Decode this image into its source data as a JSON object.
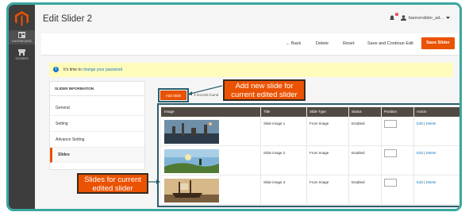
{
  "nav": {
    "items": [
      {
        "label": "DASHBOARD",
        "icon": "dashboard-icon"
      },
      {
        "label": "STORES",
        "icon": "store-icon"
      }
    ]
  },
  "header": {
    "title": "Edit Slider 2",
    "notification_count": "3",
    "username": "bannerslider_ad..."
  },
  "toolbar": {
    "back": "Back",
    "delete": "Delete",
    "reset": "Reset",
    "save_continue": "Save and Continue Edit",
    "save_slider": "Save Slider"
  },
  "notice": {
    "text": "It's time to",
    "link": "change your password"
  },
  "sidebar": {
    "heading": "SLIDER INFORMATION",
    "items": [
      {
        "label": "General"
      },
      {
        "label": "Setting"
      },
      {
        "label": "Advance Setting"
      },
      {
        "label": "Slides"
      }
    ]
  },
  "grid": {
    "add_button": "Add Slide",
    "records": "3 records found",
    "columns": [
      "Image",
      "Title",
      "Slide Type",
      "Status",
      "Position",
      "Action"
    ],
    "rows": [
      {
        "title": "Slide image 1",
        "type": "From Image",
        "status": "Enabled",
        "edit": "Edit",
        "sep": "|",
        "delete": "Delete"
      },
      {
        "title": "Slide image 2",
        "type": "From Image",
        "status": "Enabled",
        "edit": "Edit",
        "sep": "|",
        "delete": "Delete"
      },
      {
        "title": "Slide image 3",
        "type": "From Image",
        "status": "Enabled",
        "edit": "Edit",
        "sep": "|",
        "delete": "Delete"
      }
    ]
  },
  "callouts": {
    "add_new": "Add new slide for current edited slider",
    "slides": "Slides for current edited slider"
  },
  "colors": {
    "accent": "#eb5202",
    "frame": "#3aa6a0",
    "outline": "#2c5f6c",
    "grid_header": "#514943"
  }
}
